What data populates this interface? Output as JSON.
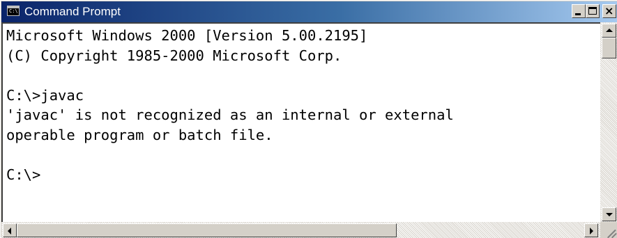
{
  "window": {
    "title": "Command Prompt",
    "icon": "console-window-icon",
    "icon_text": "C:\\",
    "buttons": {
      "minimize": "minimize-icon",
      "maximize": "maximize-icon",
      "close": "close-icon"
    }
  },
  "console": {
    "lines": [
      "Microsoft Windows 2000 [Version 5.00.2195]",
      "(C) Copyright 1985-2000 Microsoft Corp.",
      "",
      "C:\\>javac",
      "'javac' is not recognized as an internal or external",
      "operable program or batch file.",
      "",
      "C:\\>"
    ]
  },
  "scrollbars": {
    "vertical": {
      "up_icon": "scroll-up-arrow-icon",
      "down_icon": "scroll-down-arrow-icon"
    },
    "horizontal": {
      "left_icon": "scroll-left-arrow-icon",
      "right_icon": "scroll-right-arrow-icon"
    }
  },
  "colors": {
    "titlebar_start": "#0a246a",
    "titlebar_end": "#a6caf0",
    "console_bg": "#ffffff",
    "console_text": "#000000",
    "chrome": "#d4d0c8"
  }
}
